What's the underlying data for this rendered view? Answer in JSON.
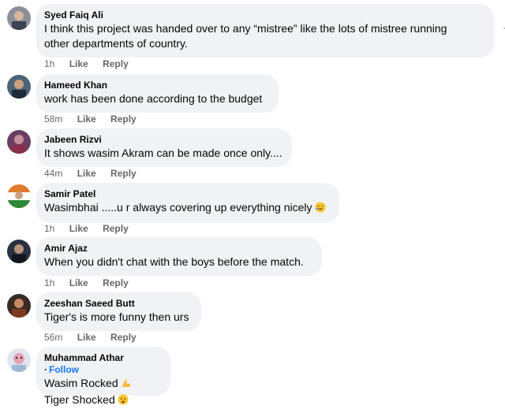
{
  "comments": [
    {
      "author": "Syed Faiq Ali",
      "lines": [
        "I think this project was handed over to any “mistree” like the lots of mistree running",
        "other departments of country."
      ],
      "time": "1h",
      "like": "Like",
      "reply": "Reply",
      "avatar_color": "#6b6f78"
    },
    {
      "author": "Hameed Khan",
      "lines": [
        "work has been done according to the budget"
      ],
      "time": "58m",
      "like": "Like",
      "reply": "Reply",
      "avatar_color": "#2f3e4e"
    },
    {
      "author": "Jabeen Rizvi",
      "lines": [
        "It shows wasim Akram can be made once only...."
      ],
      "time": "44m",
      "like": "Like",
      "reply": "Reply",
      "avatar_color": "#7a4a6b"
    },
    {
      "author": "Samir Patel",
      "lines": [
        "Wasimbhai .....u r always covering up everything nicely"
      ],
      "time": "1h",
      "like": "Like",
      "reply": "Reply",
      "avatar_color": "#3d7a3a"
    },
    {
      "author": "Amir Ajaz",
      "lines": [
        "When you didn't chat with the boys before the match."
      ],
      "time": "1h",
      "like": "Like",
      "reply": "Reply",
      "avatar_color": "#2a3140"
    },
    {
      "author": "Zeeshan Saeed Butt",
      "lines": [
        "Tiger's is more funny then urs"
      ],
      "time": "56m",
      "like": "Like",
      "reply": "Reply",
      "avatar_color": "#5a3a2e"
    },
    {
      "author": "Muhammad Athar",
      "follow": "Follow",
      "lines": [
        "Wasim Rocked",
        "Tiger Shocked"
      ],
      "avatar_color": "#c9d6e6"
    }
  ],
  "icons": {
    "laugh": "rolling-laughing-emoji",
    "muscle": "flexed-biceps-emoji",
    "sad": "sad-face-emoji"
  },
  "separator": "·"
}
